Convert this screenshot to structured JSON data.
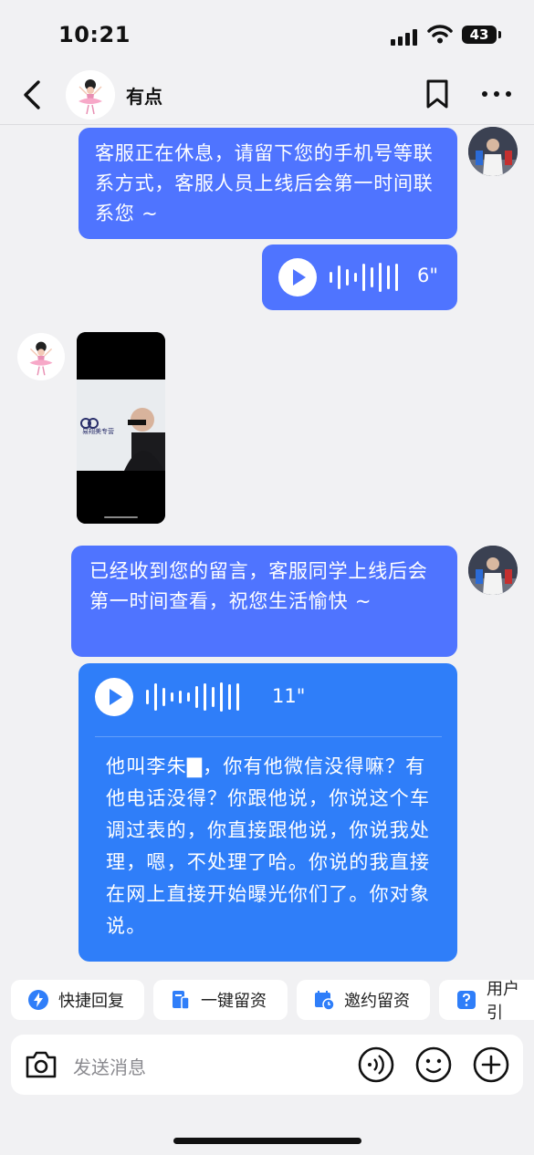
{
  "status": {
    "time": "10:21",
    "battery": "43"
  },
  "header": {
    "title": "有点"
  },
  "messages": {
    "msg1": "客服正在休息，请留下您的手机号等联系方式，客服人员上线后会第一时间联系您 ~",
    "voice1_duration": "6\"",
    "image_caption": "易翔美专营",
    "msg3": "已经收到您的留言，客服同学上线后会第一时间查看，祝您生活愉快 ~",
    "voice2_duration": "11\"",
    "transcript": "他叫李朱▇，你有他微信没得嘛？有他电话没得？你跟他说，你说这个车调过表的，你直接跟他说，你说我处理，嗯，不处理了哈。你说的我直接在网上直接开始曝光你们了。你对象说。"
  },
  "quick_replies": [
    "快捷回复",
    "一键留资",
    "邀约留资",
    "用户引"
  ],
  "input": {
    "placeholder": "发送消息"
  },
  "colors": {
    "bubble": "#4f74ff",
    "card": "#2f7ef9",
    "background": "#f1f1f3"
  }
}
